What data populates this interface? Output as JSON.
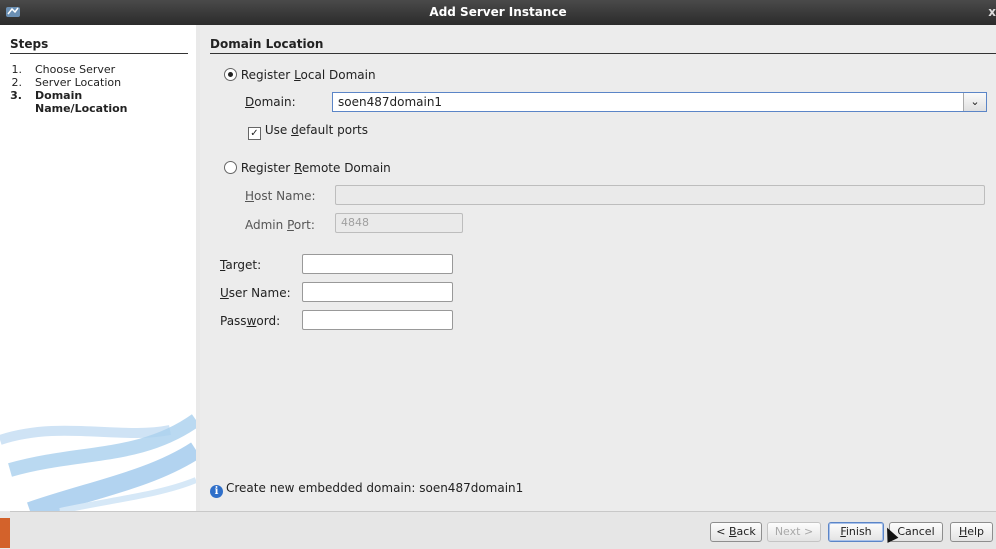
{
  "window": {
    "title": "Add Server Instance",
    "close_glyph": "x",
    "app_icon": "netbeans-icon"
  },
  "steps": {
    "title": "Steps",
    "items": [
      {
        "num": "1.",
        "label": "Choose Server"
      },
      {
        "num": "2.",
        "label": "Server Location"
      },
      {
        "num": "3.",
        "label": "Domain Name/Location"
      }
    ],
    "current_index": 2
  },
  "main": {
    "section_title": "Domain Location",
    "local": {
      "radio_label_pre": "Register ",
      "radio_label_mn": "L",
      "radio_label_post": "ocal Domain",
      "selected": true,
      "domain_label_mn": "D",
      "domain_label_post": "omain:",
      "domain_value": "soen487domain1",
      "use_default_pre": "Use ",
      "use_default_mn": "d",
      "use_default_post": "efault ports",
      "use_default_checked": true
    },
    "remote": {
      "radio_label_pre": "Register ",
      "radio_label_mn": "R",
      "radio_label_post": "emote Domain",
      "selected": false,
      "host_label_mn": "H",
      "host_label_post": "ost Name:",
      "host_value": "",
      "port_label_pre": "Admin ",
      "port_label_mn": "P",
      "port_label_post": "ort:",
      "port_placeholder": "4848"
    },
    "credentials": {
      "target_label_mn": "T",
      "target_label_post": "arget:",
      "target_value": "",
      "user_label_mn": "U",
      "user_label_post": "ser Name:",
      "user_value": "",
      "password_label_pre": "Pass",
      "password_label_mn": "w",
      "password_label_post": "ord:",
      "password_value": ""
    },
    "info_message": "Create new embedded domain: soen487domain1",
    "info_icon": "i"
  },
  "buttons": {
    "back_pre": "< ",
    "back_mn": "B",
    "back_post": "ack",
    "next": "Next >",
    "finish_mn": "F",
    "finish_post": "inish",
    "cancel": "Cancel",
    "help_mn": "H",
    "help_post": "elp"
  },
  "colors": {
    "accent": "#5b85c7",
    "titlebar": "#2b2b2b",
    "info": "#2f6fc9",
    "swoosh": "#7fb6e6"
  }
}
